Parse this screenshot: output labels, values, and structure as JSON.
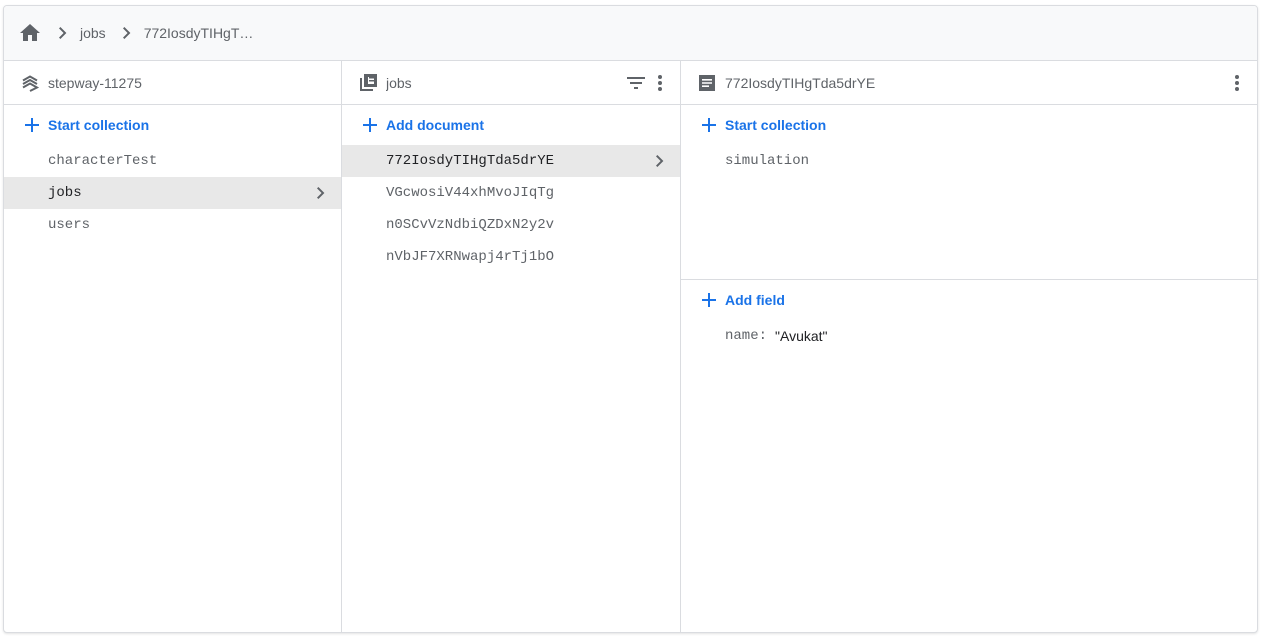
{
  "breadcrumb": {
    "home_icon": "home-icon",
    "items": [
      "jobs",
      "772IosdyTIHgT…"
    ]
  },
  "columns": {
    "root": {
      "title": "stepway-11275",
      "icon": "firestore-stack-icon",
      "action_label": "Start collection",
      "items": [
        "characterTest",
        "jobs",
        "users"
      ],
      "selected_index": 1
    },
    "collection": {
      "title": "jobs",
      "icon": "collection-icon",
      "action_label": "Add document",
      "items": [
        "772IosdyTIHgTda5drYE",
        "VGcwosiV44xhMvoJIqTg",
        "n0SCvVzNdbiQZDxN2y2v",
        "nVbJF7XRNwapj4rTj1bO"
      ],
      "selected_index": 0
    },
    "document": {
      "title": "772IosdyTIHgTda5drYE",
      "icon": "document-icon",
      "subcollections_action_label": "Start collection",
      "subcollections": [
        "simulation"
      ],
      "fields_action_label": "Add field",
      "fields": [
        {
          "key": "name",
          "value": "\"Avukat\""
        }
      ]
    }
  },
  "colors": {
    "accent": "#1a73e8",
    "selected_bg": "#e8e8e8",
    "border": "#dadce0",
    "header_bg": "#f8f9fa"
  }
}
